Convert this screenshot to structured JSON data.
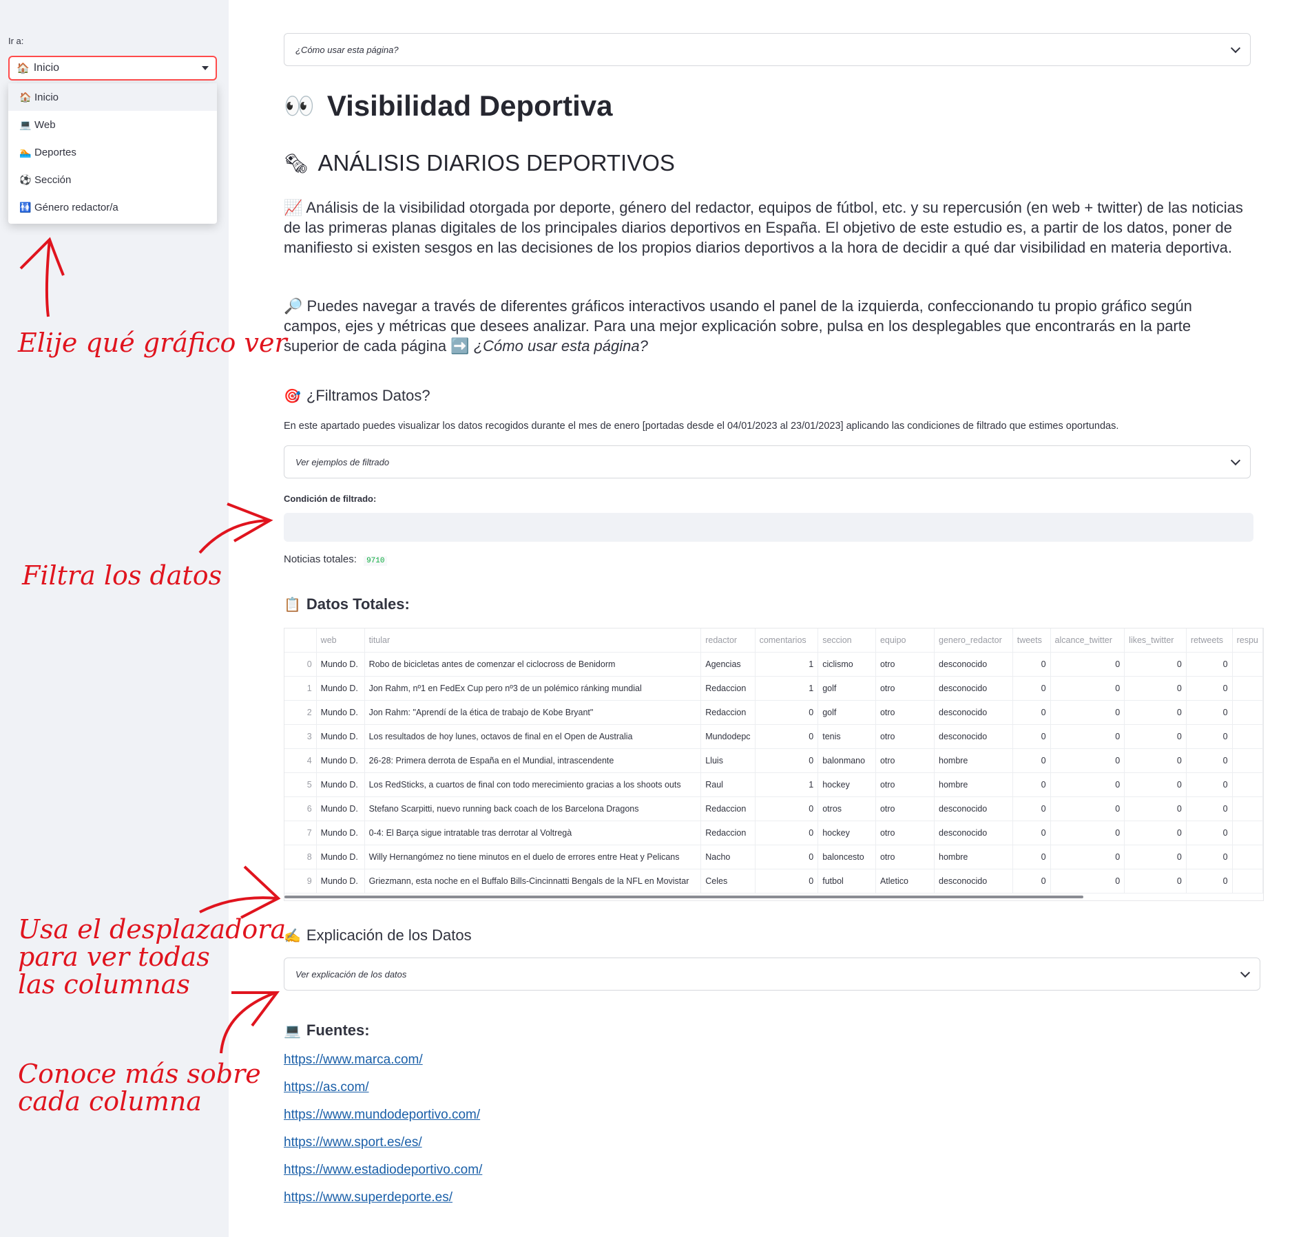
{
  "sidebar": {
    "goto_label": "Ir a:",
    "selected": "Inicio",
    "options": [
      {
        "label": "Inicio",
        "icon": "🏠"
      },
      {
        "label": "Web",
        "icon": "💻"
      },
      {
        "label": "Deportes",
        "icon": "🏊"
      },
      {
        "label": "Sección",
        "icon": "⚽"
      },
      {
        "label": "Género redactor/a",
        "icon": "🚻"
      }
    ]
  },
  "annotations": {
    "choose": "Elije qué gráfico ver",
    "filter": "Filtra los datos",
    "scroll": "Usa el desplazadora\npara ver todas\nlas columnas",
    "know": "Conoce más sobre\ncada columna"
  },
  "main": {
    "how_to_use": "¿Cómo usar esta página?",
    "title": "Visibilidad Deportiva",
    "title_icon": "👀",
    "subtitle": "ANÁLISIS DIARIOS DEPORTIVOS",
    "subtitle_icon": "🗞",
    "intro_icon": "📈",
    "intro": "Análisis de la visibilidad otorgada por deporte, género del redactor, equipos de fútbol, etc. y su repercusión (en web + twitter) de las noticias de las primeras planas digitales de los principales diarios deportivos en España. El objetivo de este estudio es, a partir de los datos, poner de manifiesto si existen sesgos en las decisiones de los propios diarios deportivos a la hora de decidir a qué dar visibilidad en materia deportiva.",
    "nav_icon": "🔎",
    "nav_text": "Puedes navegar a través de diferentes gráficos interactivos usando el panel de la izquierda, confeccionando tu propio gráfico según campos, ejes y métricas que desees analizar. Para una mejor explicación sobre, pulsa en los desplegables que encontrarás en la parte superior de cada página",
    "nav_arrow": "➡️",
    "nav_link_text": "¿Cómo usar esta página?",
    "filter_heading": "¿Filtramos Datos?",
    "filter_icon": "🎯",
    "filter_desc": "En este apartado puedes visualizar los datos recogidos durante el mes de enero [portadas desde el 04/01/2023 al 23/01/2023] aplicando las condiciones de filtrado que estimes oportundas.",
    "filter_examples": "Ver ejemplos de filtrado",
    "filter_label": "Condición de filtrado:",
    "filter_value": "",
    "total_label": "Noticias totales:",
    "total_value": "9710",
    "data_heading": "Datos Totales:",
    "data_icon": "📋",
    "explain_heading": "Explicación de los Datos",
    "explain_icon": "✍️",
    "explain_expander": "Ver explicación de los datos",
    "sources_heading": "Fuentes:",
    "sources_icon": "💻",
    "sources": [
      "https://www.marca.com/",
      "https://as.com/",
      "https://www.mundodeportivo.com/",
      "https://www.sport.es/es/",
      "https://www.estadiodeportivo.com/",
      "https://www.superdeporte.es/"
    ]
  },
  "table": {
    "columns": [
      "",
      "web",
      "titular",
      "redactor",
      "comentarios",
      "seccion",
      "equipo",
      "genero_redactor",
      "tweets",
      "alcance_twitter",
      "likes_twitter",
      "retweets",
      "respu"
    ],
    "rows": [
      [
        "0",
        "Mundo D.",
        "Robo de bicicletas antes de comenzar el ciclocross de Benidorm",
        "Agencias",
        "1",
        "ciclismo",
        "otro",
        "desconocido",
        "0",
        "0",
        "0",
        "0",
        ""
      ],
      [
        "1",
        "Mundo D.",
        "Jon Rahm, nº1 en FedEx Cup pero nº3 de un polémico ránking mundial",
        "Redaccion",
        "1",
        "golf",
        "otro",
        "desconocido",
        "0",
        "0",
        "0",
        "0",
        ""
      ],
      [
        "2",
        "Mundo D.",
        "Jon Rahm: \"Aprendí de la ética de trabajo de Kobe Bryant\"",
        "Redaccion",
        "0",
        "golf",
        "otro",
        "desconocido",
        "0",
        "0",
        "0",
        "0",
        ""
      ],
      [
        "3",
        "Mundo D.",
        "Los resultados de hoy lunes, octavos de final en el Open de Australia",
        "Mundodepc",
        "0",
        "tenis",
        "otro",
        "desconocido",
        "0",
        "0",
        "0",
        "0",
        ""
      ],
      [
        "4",
        "Mundo D.",
        "26-28: Primera derrota de España en el Mundial, intrascendente",
        "Lluis",
        "0",
        "balonmano",
        "otro",
        "hombre",
        "0",
        "0",
        "0",
        "0",
        ""
      ],
      [
        "5",
        "Mundo D.",
        "Los RedSticks, a cuartos de final con todo merecimiento gracias a los shoots outs",
        "Raul",
        "1",
        "hockey",
        "otro",
        "hombre",
        "0",
        "0",
        "0",
        "0",
        ""
      ],
      [
        "6",
        "Mundo D.",
        "Stefano Scarpitti, nuevo running back coach de los Barcelona Dragons",
        "Redaccion",
        "0",
        "otros",
        "otro",
        "desconocido",
        "0",
        "0",
        "0",
        "0",
        ""
      ],
      [
        "7",
        "Mundo D.",
        "0-4: El Barça sigue intratable tras derrotar al Voltregà",
        "Redaccion",
        "0",
        "hockey",
        "otro",
        "desconocido",
        "0",
        "0",
        "0",
        "0",
        ""
      ],
      [
        "8",
        "Mundo D.",
        "Willy Hernangómez no tiene minutos en el duelo de errores entre Heat y Pelicans",
        "Nacho",
        "0",
        "baloncesto",
        "otro",
        "hombre",
        "0",
        "0",
        "0",
        "0",
        ""
      ],
      [
        "9",
        "Mundo D.",
        "Griezmann, esta noche en el Buffalo Bills-Cincinnatti Bengals de la NFL en Movistar",
        "Celes",
        "0",
        "futbol",
        "Atletico",
        "desconocido",
        "0",
        "0",
        "0",
        "0",
        ""
      ]
    ]
  },
  "colors": {
    "accent": "#ff4b4b",
    "annotation": "#e0141e",
    "sidebar_bg": "#f0f2f6",
    "link": "#1a5fa8"
  }
}
